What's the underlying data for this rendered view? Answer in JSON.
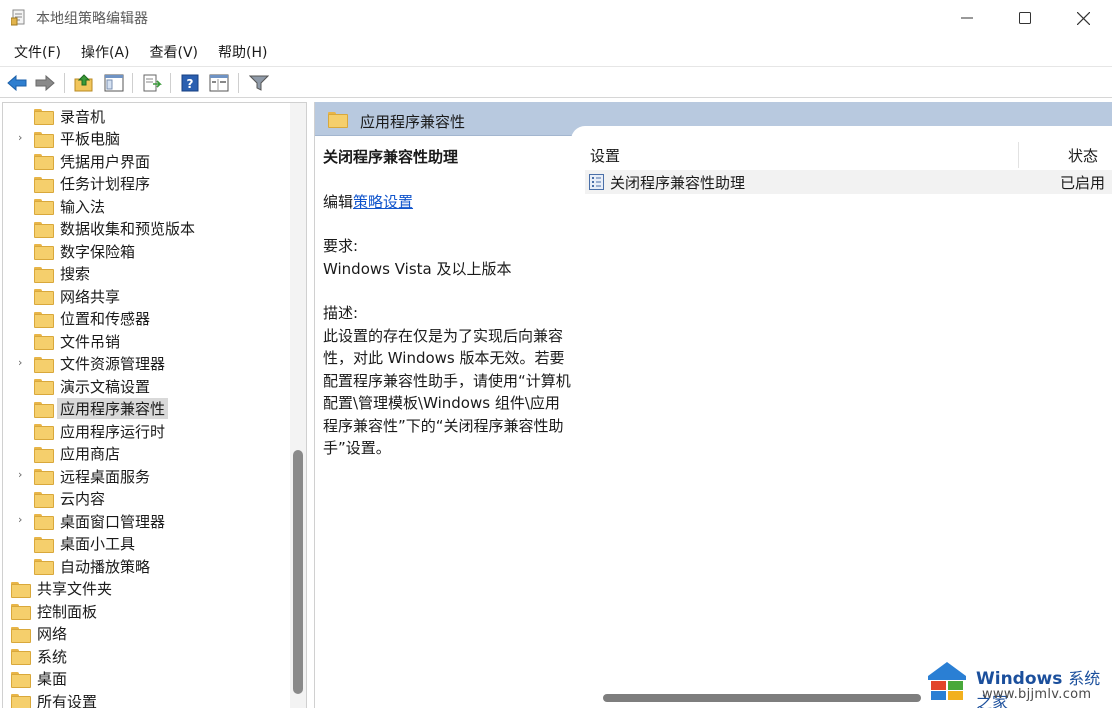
{
  "window": {
    "title": "本地组策略编辑器"
  },
  "menubar": {
    "items": [
      "文件(F)",
      "操作(A)",
      "查看(V)",
      "帮助(H)"
    ]
  },
  "toolbar": {
    "buttons": [
      "back-icon",
      "forward-icon",
      "up-folder-icon",
      "show-hide-tree-icon",
      "export-list-icon",
      "help-icon",
      "properties-icon",
      "filter-icon"
    ]
  },
  "tree": {
    "items": [
      {
        "label": "录音机",
        "expandable": false
      },
      {
        "label": "平板电脑",
        "expandable": true
      },
      {
        "label": "凭据用户界面",
        "expandable": false
      },
      {
        "label": "任务计划程序",
        "expandable": false
      },
      {
        "label": "输入法",
        "expandable": false
      },
      {
        "label": "数据收集和预览版本",
        "expandable": false
      },
      {
        "label": "数字保险箱",
        "expandable": false
      },
      {
        "label": "搜索",
        "expandable": false
      },
      {
        "label": "网络共享",
        "expandable": false
      },
      {
        "label": "位置和传感器",
        "expandable": false
      },
      {
        "label": "文件吊销",
        "expandable": false
      },
      {
        "label": "文件资源管理器",
        "expandable": true
      },
      {
        "label": "演示文稿设置",
        "expandable": false
      },
      {
        "label": "应用程序兼容性",
        "expandable": false,
        "selected": true
      },
      {
        "label": "应用程序运行时",
        "expandable": false
      },
      {
        "label": "应用商店",
        "expandable": false
      },
      {
        "label": "远程桌面服务",
        "expandable": true
      },
      {
        "label": "云内容",
        "expandable": false
      },
      {
        "label": "桌面窗口管理器",
        "expandable": true
      },
      {
        "label": "桌面小工具",
        "expandable": false
      },
      {
        "label": "自动播放策略",
        "expandable": false
      }
    ],
    "top_items": [
      {
        "label": "共享文件夹"
      },
      {
        "label": "控制面板"
      },
      {
        "label": "网络"
      },
      {
        "label": "系统"
      },
      {
        "label": "桌面"
      },
      {
        "label": "所有设置"
      }
    ]
  },
  "right_panel": {
    "header_title": "应用程序兼容性",
    "description": {
      "title": "关闭程序兼容性助理",
      "edit_prefix": "编辑",
      "edit_link": "策略设置",
      "requirement_label": "要求:",
      "requirement_value": "Windows Vista 及以上版本",
      "desc_label": "描述:",
      "desc_lines": [
        "此设置的存在仅是为了实现后向兼容",
        "性，对此 Windows 版本无效。若要",
        "配置程序兼容性助手，请使用“计算机",
        "配置\\管理模板\\Windows 组件\\应用",
        "程序兼容性”下的“关闭程序兼容性助",
        "手”设置。"
      ]
    },
    "list": {
      "col_setting": "设置",
      "col_status": "状态",
      "rows": [
        {
          "name": "关闭程序兼容性助理",
          "status": "已启用"
        }
      ]
    }
  },
  "watermark": {
    "brand": "Windows",
    "brand_sub": "系统之家",
    "url": "www.bjjmlv.com"
  }
}
